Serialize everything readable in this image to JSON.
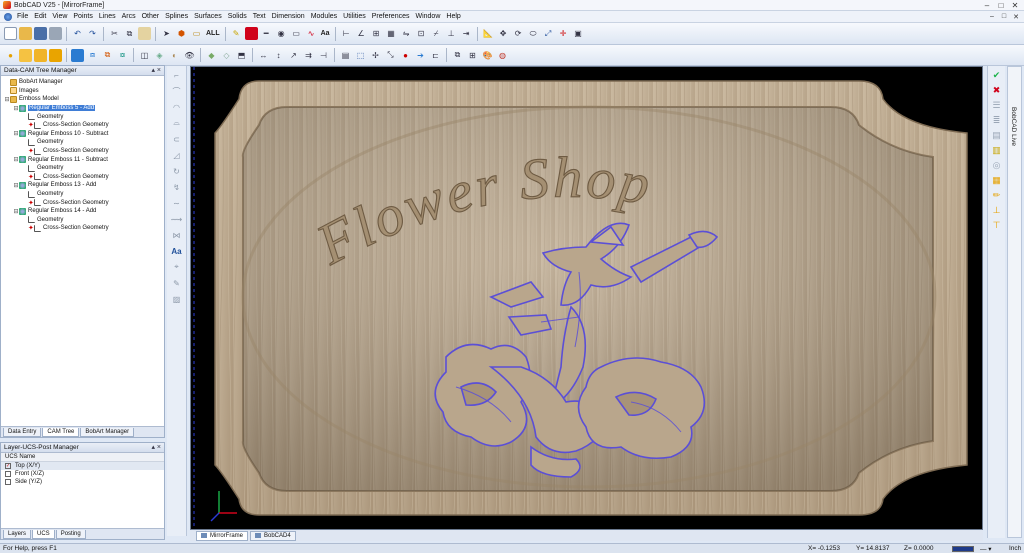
{
  "window": {
    "title": "BobCAD V25 - [MirrorFrame]",
    "minimize": "–",
    "maximize": "□",
    "close": "✕"
  },
  "menus": [
    "File",
    "Edit",
    "View",
    "Points",
    "Lines",
    "Arcs",
    "Other",
    "Splines",
    "Surfaces",
    "Solids",
    "Text",
    "Dimension",
    "Modules",
    "Utilities",
    "Preferences",
    "Window",
    "Help"
  ],
  "toolbar": {
    "all_label": "ALL",
    "aa_label": "Aa"
  },
  "cam_tree": {
    "panel_title": "Data-CAM Tree Manager",
    "pin": "▴ ×",
    "items": [
      {
        "label": "BobArt Manager",
        "level": 0,
        "icon": "folder",
        "twist": ""
      },
      {
        "label": "Images",
        "level": 0,
        "icon": "image",
        "twist": ""
      },
      {
        "label": "Emboss Model",
        "level": 0,
        "icon": "folder",
        "twist": "⊟"
      },
      {
        "label": "Regular Emboss 5 - Add",
        "level": 1,
        "icon": "emboss",
        "twist": "⊟",
        "selected": true
      },
      {
        "label": "Geometry",
        "level": 2,
        "icon": "geo",
        "twist": ""
      },
      {
        "label": "Cross-Section Geometry",
        "level": 2,
        "icon": "geo",
        "twist": "",
        "mark": true
      },
      {
        "label": "Regular Emboss 10 - Subtract",
        "level": 1,
        "icon": "emboss",
        "twist": "⊟"
      },
      {
        "label": "Geometry",
        "level": 2,
        "icon": "geo",
        "twist": ""
      },
      {
        "label": "Cross-Section Geometry",
        "level": 2,
        "icon": "geo",
        "twist": "",
        "mark": true
      },
      {
        "label": "Regular Emboss 11 - Subtract",
        "level": 1,
        "icon": "emboss",
        "twist": "⊟"
      },
      {
        "label": "Geometry",
        "level": 2,
        "icon": "geo",
        "twist": ""
      },
      {
        "label": "Cross-Section Geometry",
        "level": 2,
        "icon": "geo",
        "twist": "",
        "mark": true
      },
      {
        "label": "Regular Emboss 13 - Add",
        "level": 1,
        "icon": "emboss",
        "twist": "⊟"
      },
      {
        "label": "Geometry",
        "level": 2,
        "icon": "geo",
        "twist": ""
      },
      {
        "label": "Cross-Section Geometry",
        "level": 2,
        "icon": "geo",
        "twist": "",
        "mark": true
      },
      {
        "label": "Regular Emboss 14 - Add",
        "level": 1,
        "icon": "emboss",
        "twist": "⊟"
      },
      {
        "label": "Geometry",
        "level": 2,
        "icon": "geo",
        "twist": ""
      },
      {
        "label": "Cross-Section Geometry",
        "level": 2,
        "icon": "geo",
        "twist": "",
        "mark": true
      }
    ],
    "tabs": [
      "Data Entry",
      "CAM Tree",
      "BobArt Manager"
    ]
  },
  "layer_panel": {
    "title": "Layer-UCS-Post Manager",
    "pin": "▴ ×",
    "column": "UCS Name",
    "rows": [
      "Top (X/Y)",
      "Front (X/Z)",
      "Side (Y/Z)"
    ],
    "tabs": [
      "Layers",
      "UCS",
      "Posting"
    ]
  },
  "viewport": {
    "sign_text": "Flower Shop",
    "tabs": [
      "MirrorFrame",
      "BobCAD4"
    ]
  },
  "right_panel": {
    "live_label": "BobCAD Live",
    "accept": "✔",
    "reject": "✖"
  },
  "status": {
    "help": "For Help, press F1",
    "x": "X= -0.1253",
    "y": "Y= 14.8137",
    "z": "Z= 0.0000",
    "line_style": "Inch"
  },
  "colors": {
    "wood": "#b9a68c",
    "emboss_outline": "#5b4fd6",
    "selection": "#3f7dd6"
  }
}
